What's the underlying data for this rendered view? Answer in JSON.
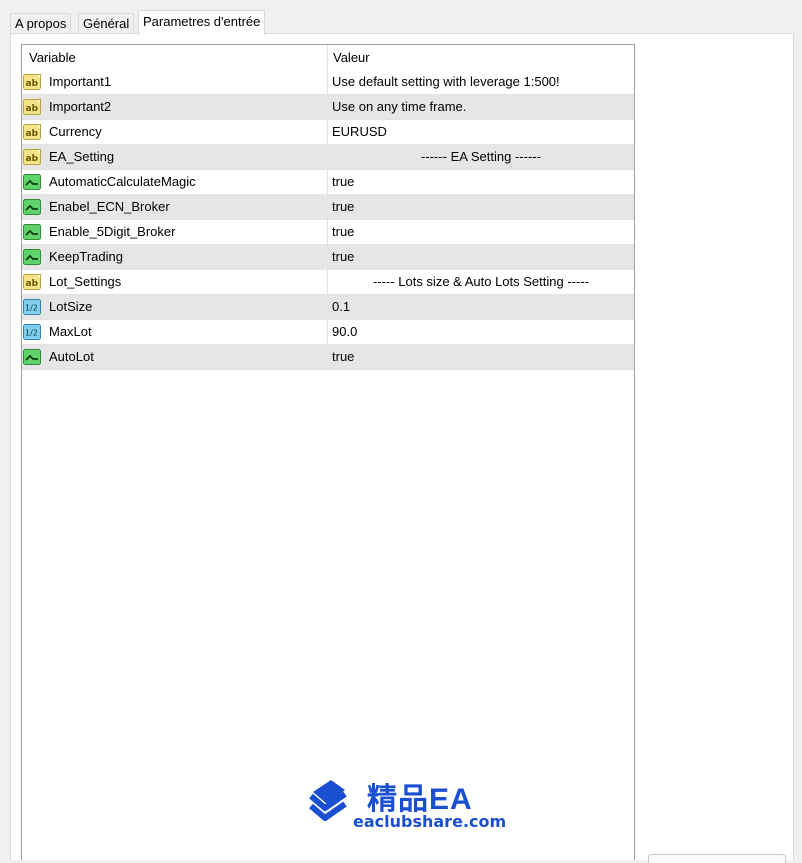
{
  "tabs": [
    {
      "label": "A propos",
      "active": false
    },
    {
      "label": "Général",
      "active": false
    },
    {
      "label": "Parametres d'entrée",
      "active": true
    }
  ],
  "table": {
    "headers": {
      "variable": "Variable",
      "value": "Valeur"
    },
    "rows": [
      {
        "icon": "string-ab-icon",
        "name": "Important1",
        "value": "Use default setting with leverage 1:500!",
        "align": "left"
      },
      {
        "icon": "string-ab-icon",
        "name": "Important2",
        "value": "Use on any time frame.",
        "align": "left"
      },
      {
        "icon": "string-ab-icon",
        "name": "Currency",
        "value": "EURUSD",
        "align": "left"
      },
      {
        "icon": "string-ab-icon",
        "name": "EA_Setting",
        "value": "------ EA Setting ------",
        "align": "center"
      },
      {
        "icon": "bool-switch-icon",
        "name": "AutomaticCalculateMagic",
        "value": "true",
        "align": "left"
      },
      {
        "icon": "bool-switch-icon",
        "name": "Enabel_ECN_Broker",
        "value": "true",
        "align": "left"
      },
      {
        "icon": "bool-switch-icon",
        "name": "Enable_5Digit_Broker",
        "value": "true",
        "align": "left"
      },
      {
        "icon": "bool-switch-icon",
        "name": "KeepTrading",
        "value": "true",
        "align": "left"
      },
      {
        "icon": "string-ab-icon",
        "name": "Lot_Settings",
        "value": "----- Lots size & Auto Lots Setting -----",
        "align": "center"
      },
      {
        "icon": "double-value-icon",
        "name": "LotSize",
        "value": "0.1",
        "align": "left"
      },
      {
        "icon": "double-value-icon",
        "name": "MaxLot",
        "value": "90.0",
        "align": "left"
      },
      {
        "icon": "bool-switch-icon",
        "name": "AutoLot",
        "value": "true",
        "align": "left"
      }
    ]
  },
  "watermark": {
    "logo_icon": "stacked-book-logo-icon",
    "title": "精品EA",
    "url": "eaclubshare.com",
    "color": "#1a4fd1"
  }
}
